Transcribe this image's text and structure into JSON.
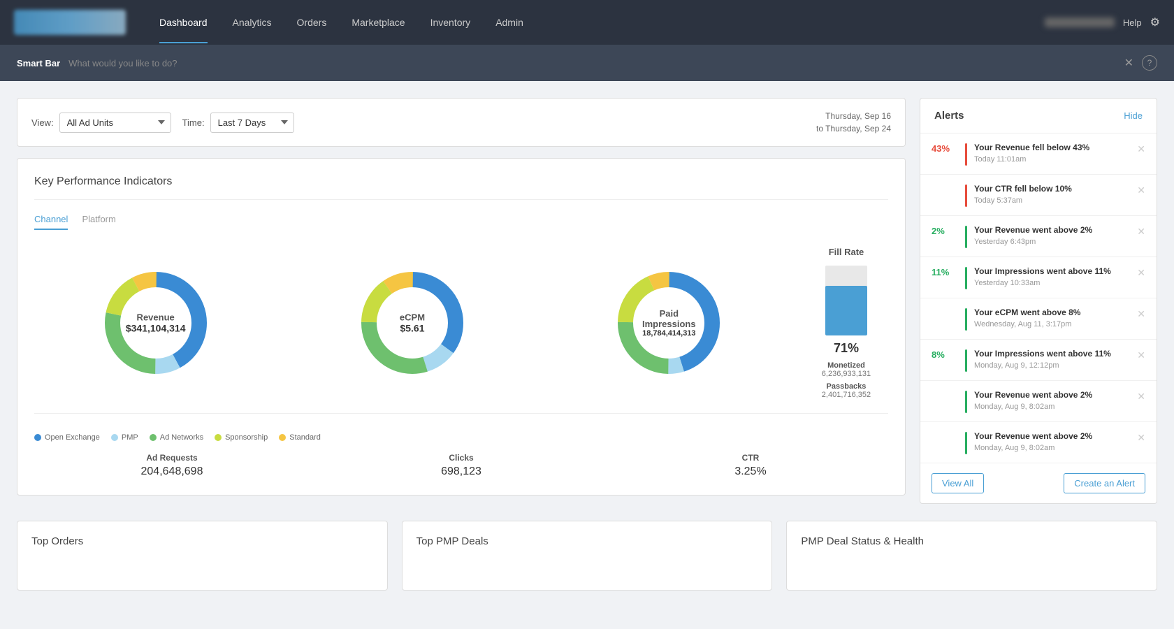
{
  "nav": {
    "links": [
      {
        "label": "Dashboard",
        "active": true
      },
      {
        "label": "Analytics",
        "active": false
      },
      {
        "label": "Orders",
        "active": false
      },
      {
        "label": "Marketplace",
        "active": false
      },
      {
        "label": "Inventory",
        "active": false
      },
      {
        "label": "Admin",
        "active": false
      }
    ],
    "help": "Help"
  },
  "smartbar": {
    "label": "Smart Bar",
    "placeholder": "What would you like to do?"
  },
  "filter": {
    "view_label": "View:",
    "view_value": "All Ad Units",
    "time_label": "Time:",
    "time_value": "Last 7 Days",
    "date_line1": "Thursday, Sep 16",
    "date_line2": "to Thursday, Sep 24"
  },
  "kpi": {
    "title": "Key Performance Indicators",
    "tabs": [
      "Channel",
      "Platform"
    ],
    "charts": [
      {
        "label": "Revenue",
        "value": "$341,104,314",
        "segments": [
          {
            "color": "#3a8bd4",
            "percent": 42
          },
          {
            "color": "#a8d8f0",
            "percent": 8
          },
          {
            "color": "#6ec06e",
            "percent": 28
          },
          {
            "color": "#c8dc40",
            "percent": 14
          },
          {
            "color": "#f5c542",
            "percent": 8
          }
        ]
      },
      {
        "label": "eCPM",
        "value": "$5.61",
        "segments": [
          {
            "color": "#3a8bd4",
            "percent": 35
          },
          {
            "color": "#a8d8f0",
            "percent": 10
          },
          {
            "color": "#6ec06e",
            "percent": 30
          },
          {
            "color": "#c8dc40",
            "percent": 15
          },
          {
            "color": "#f5c542",
            "percent": 10
          }
        ]
      },
      {
        "label": "Paid Impressions",
        "value": "18,784,414,313",
        "segments": [
          {
            "color": "#3a8bd4",
            "percent": 45
          },
          {
            "color": "#a8d8f0",
            "percent": 5
          },
          {
            "color": "#6ec06e",
            "percent": 25
          },
          {
            "color": "#c8dc40",
            "percent": 18
          },
          {
            "color": "#f5c542",
            "percent": 7
          }
        ]
      }
    ],
    "fill_rate": {
      "title": "Fill Rate",
      "percent": "71%",
      "fill_value": 71,
      "monetized_label": "Monetized",
      "monetized_value": "6,236,933,131",
      "passbacks_label": "Passbacks",
      "passbacks_value": "2,401,716,352"
    },
    "legend": [
      {
        "color": "#3a8bd4",
        "label": "Open Exchange"
      },
      {
        "color": "#a8d8f0",
        "label": "PMP"
      },
      {
        "color": "#6ec06e",
        "label": "Ad Networks"
      },
      {
        "color": "#c8dc40",
        "label": "Sponsorship"
      },
      {
        "color": "#f5c542",
        "label": "Standard"
      }
    ],
    "stats": [
      {
        "name": "Ad Requests",
        "value": "204,648,698"
      },
      {
        "name": "Clicks",
        "value": "698,123"
      },
      {
        "name": "CTR",
        "value": "3.25%"
      }
    ]
  },
  "alerts": {
    "title": "Alerts",
    "hide_label": "Hide",
    "items": [
      {
        "badge": "43%",
        "type": "red",
        "message": "Your Revenue fell below 43%",
        "time": "Today 11:01am"
      },
      {
        "badge": "",
        "type": "red",
        "message": "Your CTR fell below 10%",
        "time": "Today 5:37am"
      },
      {
        "badge": "2%",
        "type": "green",
        "message": "Your Revenue went above 2%",
        "time": "Yesterday 6:43pm"
      },
      {
        "badge": "11%",
        "type": "green",
        "message": "Your Impressions went above 11%",
        "time": "Yesterday 10:33am"
      },
      {
        "badge": "",
        "type": "green",
        "message": "Your eCPM went above 8%",
        "time": "Wednesday, Aug 11, 3:17pm"
      },
      {
        "badge": "8%",
        "type": "green",
        "message": "Your Impressions went above 11%",
        "time": "Monday, Aug 9, 12:12pm"
      },
      {
        "badge": "",
        "type": "green",
        "message": "Your Revenue went above 2%",
        "time": "Monday, Aug 9, 8:02am"
      },
      {
        "badge": "",
        "type": "green",
        "message": "Your Revenue went above 2%",
        "time": "Monday, Aug 9, 8:02am"
      }
    ],
    "view_all": "View All",
    "create_alert": "Create an Alert"
  },
  "bottom_cards": [
    {
      "title": "Top Orders"
    },
    {
      "title": "Top PMP Deals"
    },
    {
      "title": "PMP Deal Status & Health"
    }
  ]
}
